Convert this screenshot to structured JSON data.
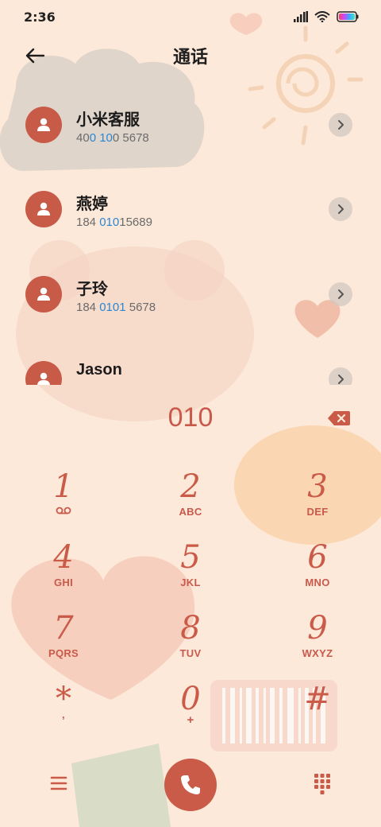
{
  "status_bar": {
    "time": "2:36",
    "icons": [
      "signal-icon",
      "wifi-icon",
      "battery-icon"
    ]
  },
  "app_bar": {
    "title": "通话",
    "back_icon": "arrow-left-icon"
  },
  "contacts": [
    {
      "name": "小米客服",
      "number_parts": [
        "40",
        "0 10",
        "0 5678"
      ]
    },
    {
      "name": "燕婷",
      "number_parts": [
        "184 ",
        "010",
        "15689"
      ]
    },
    {
      "name": "子玲",
      "number_parts": [
        "184 ",
        "0101",
        " 5678"
      ]
    },
    {
      "name": "Jason",
      "number_parts": [
        "",
        "",
        ""
      ]
    }
  ],
  "dialer": {
    "input_value": "010"
  },
  "keypad": [
    {
      "digit": "1",
      "letters": ""
    },
    {
      "digit": "2",
      "letters": "ABC"
    },
    {
      "digit": "3",
      "letters": "DEF"
    },
    {
      "digit": "4",
      "letters": "GHI"
    },
    {
      "digit": "5",
      "letters": "JKL"
    },
    {
      "digit": "6",
      "letters": "MNO"
    },
    {
      "digit": "7",
      "letters": "PQRS"
    },
    {
      "digit": "8",
      "letters": "TUV"
    },
    {
      "digit": "9",
      "letters": "WXYZ"
    },
    {
      "digit": "*",
      "letters": ","
    },
    {
      "digit": "0",
      "letters": "+"
    },
    {
      "digit": "#",
      "letters": ""
    }
  ],
  "colors": {
    "accent": "#c95b48",
    "highlight_number": "#2a87d6",
    "background": "#fde9d9"
  }
}
